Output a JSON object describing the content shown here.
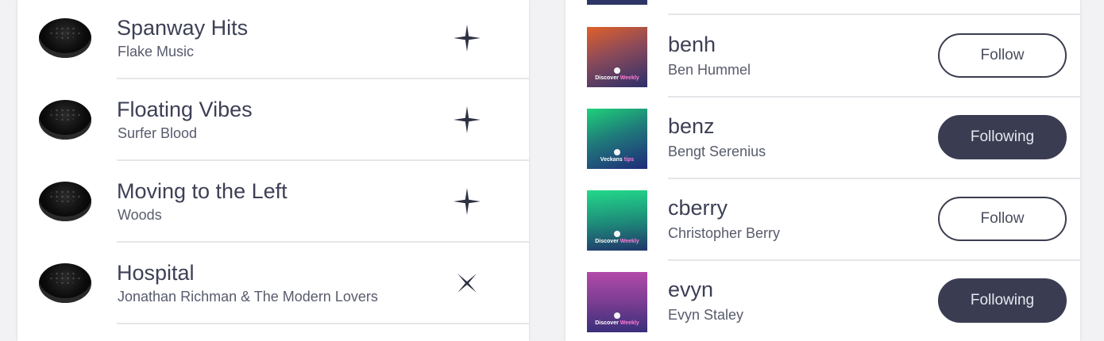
{
  "tracks": [
    {
      "title": "Spanway Hits",
      "artist": "Flake Music",
      "action": "add-icon"
    },
    {
      "title": "Floating Vibes",
      "artist": "Surfer Blood",
      "action": "add-icon"
    },
    {
      "title": "Moving to the Left",
      "artist": "Woods",
      "action": "add-icon"
    },
    {
      "title": "Hospital",
      "artist": "Jonathan Richman & The Modern Lovers",
      "action": "remove-icon"
    }
  ],
  "users": [
    {
      "handle": "benh",
      "name": "Ben Hummel",
      "button": "Follow",
      "following": false,
      "badge": {
        "prefix": "Discover ",
        "accent": "Weekly"
      },
      "avatar_colors": [
        "#e0602a",
        "#2c2f6a"
      ]
    },
    {
      "handle": "benz",
      "name": "Bengt Serenius",
      "button": "Following",
      "following": true,
      "badge": {
        "prefix": "Veckans ",
        "accent": "tips"
      },
      "avatar_colors": [
        "#1fd17a",
        "#1f2a7a"
      ]
    },
    {
      "handle": "cberry",
      "name": "Christopher Berry",
      "button": "Follow",
      "following": false,
      "badge": {
        "prefix": "Discover ",
        "accent": "Weekly"
      },
      "avatar_colors": [
        "#23d98a",
        "#20366a"
      ]
    },
    {
      "handle": "evyn",
      "name": "Evyn Staley",
      "button": "Following",
      "following": true,
      "badge": {
        "prefix": "Discover ",
        "accent": "Weekly"
      },
      "avatar_colors": [
        "#b24aa8",
        "#3a2f7a"
      ]
    }
  ],
  "colors": {
    "text_primary": "#3d4055",
    "button_dark": "#3a3d52",
    "divider": "#e6e6ea"
  }
}
